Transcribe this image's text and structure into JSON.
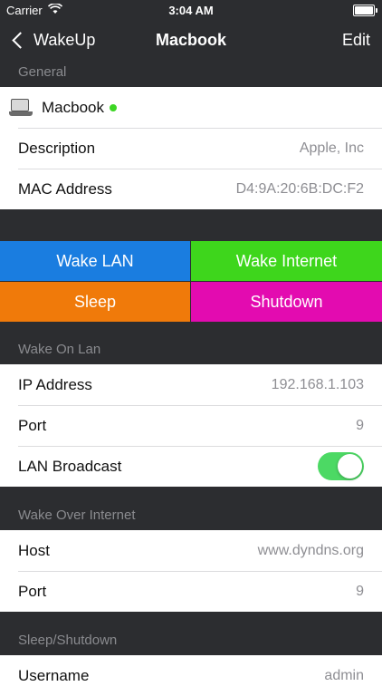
{
  "status": {
    "carrier": "Carrier",
    "time": "3:04 AM"
  },
  "nav": {
    "back_label": "WakeUp",
    "title": "Macbook",
    "edit_label": "Edit"
  },
  "general": {
    "header": "General",
    "device_name": "Macbook",
    "status_color": "#3dd624",
    "rows": [
      {
        "label": "Description",
        "value": "Apple, Inc"
      },
      {
        "label": "MAC Address",
        "value": "D4:9A:20:6B:DC:F2"
      }
    ]
  },
  "actions": {
    "wake_lan": {
      "label": "Wake LAN",
      "color": "#1a7de0"
    },
    "wake_internet": {
      "label": "Wake Internet",
      "color": "#3ed61c"
    },
    "sleep": {
      "label": "Sleep",
      "color": "#f07a0a"
    },
    "shutdown": {
      "label": "Shutdown",
      "color": "#e30bb0"
    }
  },
  "wake_on_lan": {
    "header": "Wake On Lan",
    "rows": [
      {
        "label": "IP Address",
        "value": "192.168.1.103"
      },
      {
        "label": "Port",
        "value": "9"
      },
      {
        "label": "LAN Broadcast",
        "toggle_on": true
      }
    ]
  },
  "wake_over_internet": {
    "header": "Wake Over Internet",
    "rows": [
      {
        "label": "Host",
        "value": "www.dyndns.org"
      },
      {
        "label": "Port",
        "value": "9"
      }
    ]
  },
  "sleep_shutdown": {
    "header": "Sleep/Shutdown",
    "rows": [
      {
        "label": "Username",
        "value": "admin"
      }
    ]
  }
}
